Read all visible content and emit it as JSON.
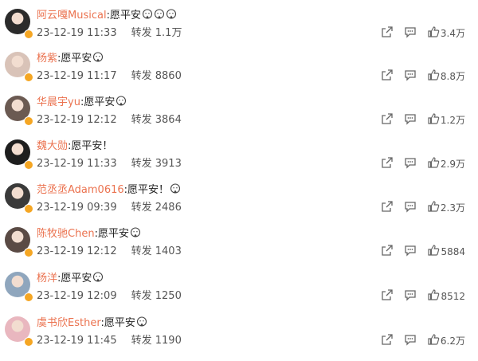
{
  "comments": [
    {
      "user": "阿云嘎Musical",
      "text": ":愿平安",
      "emoji_count": 3,
      "date": "23-12-19 11:33",
      "repost_label": "转发",
      "reposts": "1.1万",
      "likes": "3.4万",
      "avatar_color": "#2b2b2b"
    },
    {
      "user": "杨紫",
      "text": ":愿平安",
      "emoji_count": 1,
      "date": "23-12-19 11:17",
      "repost_label": "转发",
      "reposts": "8860",
      "likes": "8.8万",
      "avatar_color": "#d9c3b8"
    },
    {
      "user": "华晨宇yu",
      "text": ":愿平安",
      "emoji_count": 1,
      "date": "23-12-19 12:12",
      "repost_label": "转发",
      "reposts": "3864",
      "likes": "1.2万",
      "avatar_color": "#6b5a52"
    },
    {
      "user": "魏大勋",
      "text": ":愿平安！",
      "emoji_count": 0,
      "date": "23-12-19 11:33",
      "repost_label": "转发",
      "reposts": "3913",
      "likes": "2.9万",
      "avatar_color": "#1e1e1e"
    },
    {
      "user": "范丞丞Adam0616",
      "text": ":愿平安！",
      "emoji_count": 1,
      "date": "23-12-19 09:39",
      "repost_label": "转发",
      "reposts": "2486",
      "likes": "2.3万",
      "avatar_color": "#3a3a3a"
    },
    {
      "user": "陈牧驰Chen",
      "text": ":愿平安",
      "emoji_count": 1,
      "date": "23-12-19 12:12",
      "repost_label": "转发",
      "reposts": "1403",
      "likes": "5884",
      "avatar_color": "#5a4a44"
    },
    {
      "user": "杨洋",
      "text": ":愿平安",
      "emoji_count": 1,
      "date": "23-12-19 12:09",
      "repost_label": "转发",
      "reposts": "1250",
      "likes": "8512",
      "avatar_color": "#8fa6bd"
    },
    {
      "user": "虞书欣Esther",
      "text": ":愿平安",
      "emoji_count": 1,
      "date": "23-12-19 11:45",
      "repost_label": "转发",
      "reposts": "1190",
      "likes": "6.2万",
      "avatar_color": "#e9b7bf"
    }
  ]
}
